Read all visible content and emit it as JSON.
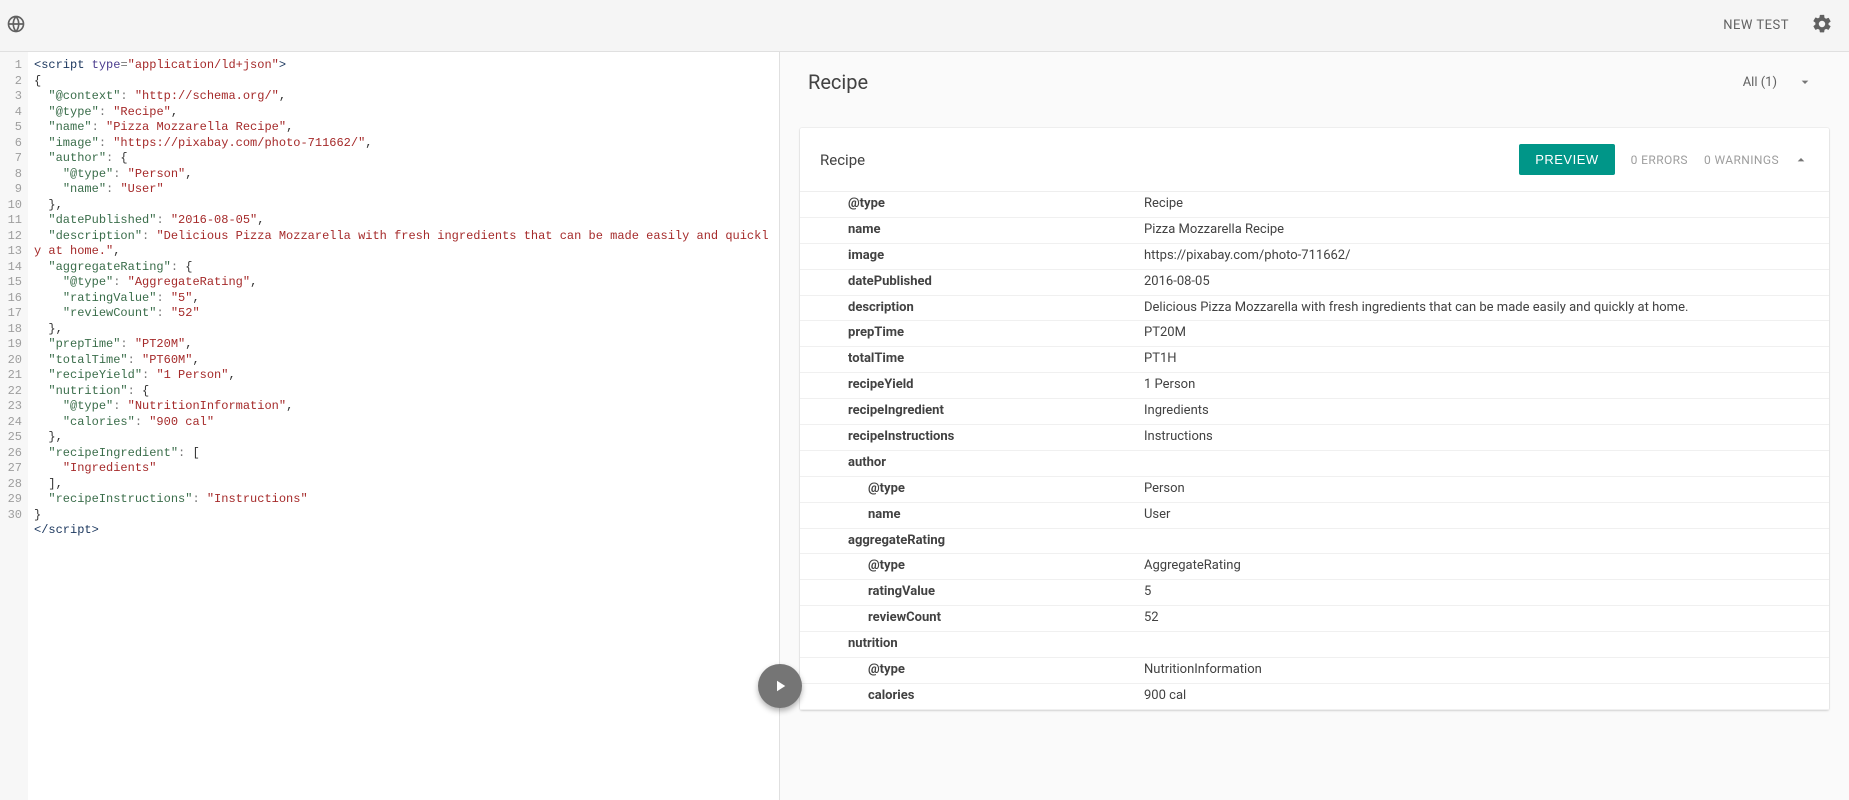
{
  "topbar": {
    "new_test_label": "NEW TEST"
  },
  "right": {
    "title": "Recipe",
    "all_label": "All (1)",
    "card_title": "Recipe",
    "preview_label": "PREVIEW",
    "errors_label": "0 ERRORS",
    "warnings_label": "0 WARNINGS",
    "rows": [
      {
        "indent": 0,
        "key": "@type",
        "val": "Recipe"
      },
      {
        "indent": 0,
        "key": "name",
        "val": "Pizza Mozzarella Recipe"
      },
      {
        "indent": 0,
        "key": "image",
        "val": "https://pixabay.com/photo-711662/"
      },
      {
        "indent": 0,
        "key": "datePublished",
        "val": "2016-08-05"
      },
      {
        "indent": 0,
        "key": "description",
        "val": "Delicious Pizza Mozzarella with fresh ingredients that can be made easily and quickly at home."
      },
      {
        "indent": 0,
        "key": "prepTime",
        "val": "PT20M"
      },
      {
        "indent": 0,
        "key": "totalTime",
        "val": "PT1H"
      },
      {
        "indent": 0,
        "key": "recipeYield",
        "val": "1 Person"
      },
      {
        "indent": 0,
        "key": "recipeIngredient",
        "val": "Ingredients"
      },
      {
        "indent": 0,
        "key": "recipeInstructions",
        "val": "Instructions"
      },
      {
        "indent": 0,
        "key": "author",
        "val": ""
      },
      {
        "indent": 1,
        "key": "@type",
        "val": "Person"
      },
      {
        "indent": 1,
        "key": "name",
        "val": "User"
      },
      {
        "indent": 0,
        "key": "aggregateRating",
        "val": ""
      },
      {
        "indent": 1,
        "key": "@type",
        "val": "AggregateRating"
      },
      {
        "indent": 1,
        "key": "ratingValue",
        "val": "5"
      },
      {
        "indent": 1,
        "key": "reviewCount",
        "val": "52"
      },
      {
        "indent": 0,
        "key": "nutrition",
        "val": ""
      },
      {
        "indent": 1,
        "key": "@type",
        "val": "NutritionInformation"
      },
      {
        "indent": 1,
        "key": "calories",
        "val": "900 cal"
      }
    ]
  },
  "code": {
    "line_count": 30,
    "tokens": [
      [
        {
          "c": "k-tag",
          "t": "<script"
        },
        {
          "c": "",
          "t": " "
        },
        {
          "c": "k-attr",
          "t": "type"
        },
        {
          "c": "k-op",
          "t": "="
        },
        {
          "c": "k-str",
          "t": "\"application/ld+json\""
        },
        {
          "c": "k-tag",
          "t": ">"
        }
      ],
      [
        {
          "c": "",
          "t": "{"
        }
      ],
      [
        {
          "c": "",
          "t": "  "
        },
        {
          "c": "k-key",
          "t": "\"@context\""
        },
        {
          "c": "k-op",
          "t": ": "
        },
        {
          "c": "k-str",
          "t": "\"http://schema.org/\""
        },
        {
          "c": "",
          "t": ","
        }
      ],
      [
        {
          "c": "",
          "t": "  "
        },
        {
          "c": "k-key",
          "t": "\"@type\""
        },
        {
          "c": "k-op",
          "t": ": "
        },
        {
          "c": "k-str",
          "t": "\"Recipe\""
        },
        {
          "c": "",
          "t": ","
        }
      ],
      [
        {
          "c": "",
          "t": "  "
        },
        {
          "c": "k-key",
          "t": "\"name\""
        },
        {
          "c": "k-op",
          "t": ": "
        },
        {
          "c": "k-str",
          "t": "\"Pizza Mozzarella Recipe\""
        },
        {
          "c": "",
          "t": ","
        }
      ],
      [
        {
          "c": "",
          "t": "  "
        },
        {
          "c": "k-key",
          "t": "\"image\""
        },
        {
          "c": "k-op",
          "t": ": "
        },
        {
          "c": "k-str",
          "t": "\"https://pixabay.com/photo-711662/\""
        },
        {
          "c": "",
          "t": ","
        }
      ],
      [
        {
          "c": "",
          "t": "  "
        },
        {
          "c": "k-key",
          "t": "\"author\""
        },
        {
          "c": "k-op",
          "t": ": "
        },
        {
          "c": "",
          "t": "{"
        }
      ],
      [
        {
          "c": "",
          "t": "    "
        },
        {
          "c": "k-key",
          "t": "\"@type\""
        },
        {
          "c": "k-op",
          "t": ": "
        },
        {
          "c": "k-str",
          "t": "\"Person\""
        },
        {
          "c": "",
          "t": ","
        }
      ],
      [
        {
          "c": "",
          "t": "    "
        },
        {
          "c": "k-key",
          "t": "\"name\""
        },
        {
          "c": "k-op",
          "t": ": "
        },
        {
          "c": "k-str",
          "t": "\"User\""
        }
      ],
      [
        {
          "c": "",
          "t": "  "
        },
        {
          "c": "",
          "t": "},"
        }
      ],
      [
        {
          "c": "",
          "t": "  "
        },
        {
          "c": "k-key",
          "t": "\"datePublished\""
        },
        {
          "c": "k-op",
          "t": ": "
        },
        {
          "c": "k-str",
          "t": "\"2016-08-05\""
        },
        {
          "c": "",
          "t": ","
        }
      ],
      [
        {
          "c": "",
          "t": "  "
        },
        {
          "c": "k-key",
          "t": "\"description\""
        },
        {
          "c": "k-op",
          "t": ": "
        },
        {
          "c": "k-str",
          "t": "\"Delicious Pizza Mozzarella with fresh ingredients that can be made easily and quickly at home.\""
        },
        {
          "c": "",
          "t": ","
        }
      ],
      [
        {
          "c": "",
          "t": "  "
        },
        {
          "c": "k-key",
          "t": "\"aggregateRating\""
        },
        {
          "c": "k-op",
          "t": ": "
        },
        {
          "c": "",
          "t": "{"
        }
      ],
      [
        {
          "c": "",
          "t": "    "
        },
        {
          "c": "k-key",
          "t": "\"@type\""
        },
        {
          "c": "k-op",
          "t": ": "
        },
        {
          "c": "k-str",
          "t": "\"AggregateRating\""
        },
        {
          "c": "",
          "t": ","
        }
      ],
      [
        {
          "c": "",
          "t": "    "
        },
        {
          "c": "k-key",
          "t": "\"ratingValue\""
        },
        {
          "c": "k-op",
          "t": ": "
        },
        {
          "c": "k-str",
          "t": "\"5\""
        },
        {
          "c": "",
          "t": ","
        }
      ],
      [
        {
          "c": "",
          "t": "    "
        },
        {
          "c": "k-key",
          "t": "\"reviewCount\""
        },
        {
          "c": "k-op",
          "t": ": "
        },
        {
          "c": "k-str",
          "t": "\"52\""
        }
      ],
      [
        {
          "c": "",
          "t": "  "
        },
        {
          "c": "",
          "t": "},"
        }
      ],
      [
        {
          "c": "",
          "t": "  "
        },
        {
          "c": "k-key",
          "t": "\"prepTime\""
        },
        {
          "c": "k-op",
          "t": ": "
        },
        {
          "c": "k-str",
          "t": "\"PT20M\""
        },
        {
          "c": "",
          "t": ","
        }
      ],
      [
        {
          "c": "",
          "t": "  "
        },
        {
          "c": "k-key",
          "t": "\"totalTime\""
        },
        {
          "c": "k-op",
          "t": ": "
        },
        {
          "c": "k-str",
          "t": "\"PT60M\""
        },
        {
          "c": "",
          "t": ","
        }
      ],
      [
        {
          "c": "",
          "t": "  "
        },
        {
          "c": "k-key",
          "t": "\"recipeYield\""
        },
        {
          "c": "k-op",
          "t": ": "
        },
        {
          "c": "k-str",
          "t": "\"1 Person\""
        },
        {
          "c": "",
          "t": ","
        }
      ],
      [
        {
          "c": "",
          "t": "  "
        },
        {
          "c": "k-key",
          "t": "\"nutrition\""
        },
        {
          "c": "k-op",
          "t": ": "
        },
        {
          "c": "",
          "t": "{"
        }
      ],
      [
        {
          "c": "",
          "t": "    "
        },
        {
          "c": "k-key",
          "t": "\"@type\""
        },
        {
          "c": "k-op",
          "t": ": "
        },
        {
          "c": "k-str",
          "t": "\"NutritionInformation\""
        },
        {
          "c": "",
          "t": ","
        }
      ],
      [
        {
          "c": "",
          "t": "    "
        },
        {
          "c": "k-key",
          "t": "\"calories\""
        },
        {
          "c": "k-op",
          "t": ": "
        },
        {
          "c": "k-str",
          "t": "\"900 cal\""
        }
      ],
      [
        {
          "c": "",
          "t": "  "
        },
        {
          "c": "",
          "t": "},"
        }
      ],
      [
        {
          "c": "",
          "t": "  "
        },
        {
          "c": "k-key",
          "t": "\"recipeIngredient\""
        },
        {
          "c": "k-op",
          "t": ": "
        },
        {
          "c": "",
          "t": "["
        }
      ],
      [
        {
          "c": "",
          "t": "    "
        },
        {
          "c": "k-str",
          "t": "\"Ingredients\""
        }
      ],
      [
        {
          "c": "",
          "t": "  "
        },
        {
          "c": "",
          "t": "],"
        }
      ],
      [
        {
          "c": "",
          "t": "  "
        },
        {
          "c": "k-key",
          "t": "\"recipeInstructions\""
        },
        {
          "c": "k-op",
          "t": ": "
        },
        {
          "c": "k-str",
          "t": "\"Instructions\""
        }
      ],
      [
        {
          "c": "",
          "t": "}"
        }
      ],
      [
        {
          "c": "k-tag",
          "t": "</script>"
        }
      ]
    ]
  }
}
